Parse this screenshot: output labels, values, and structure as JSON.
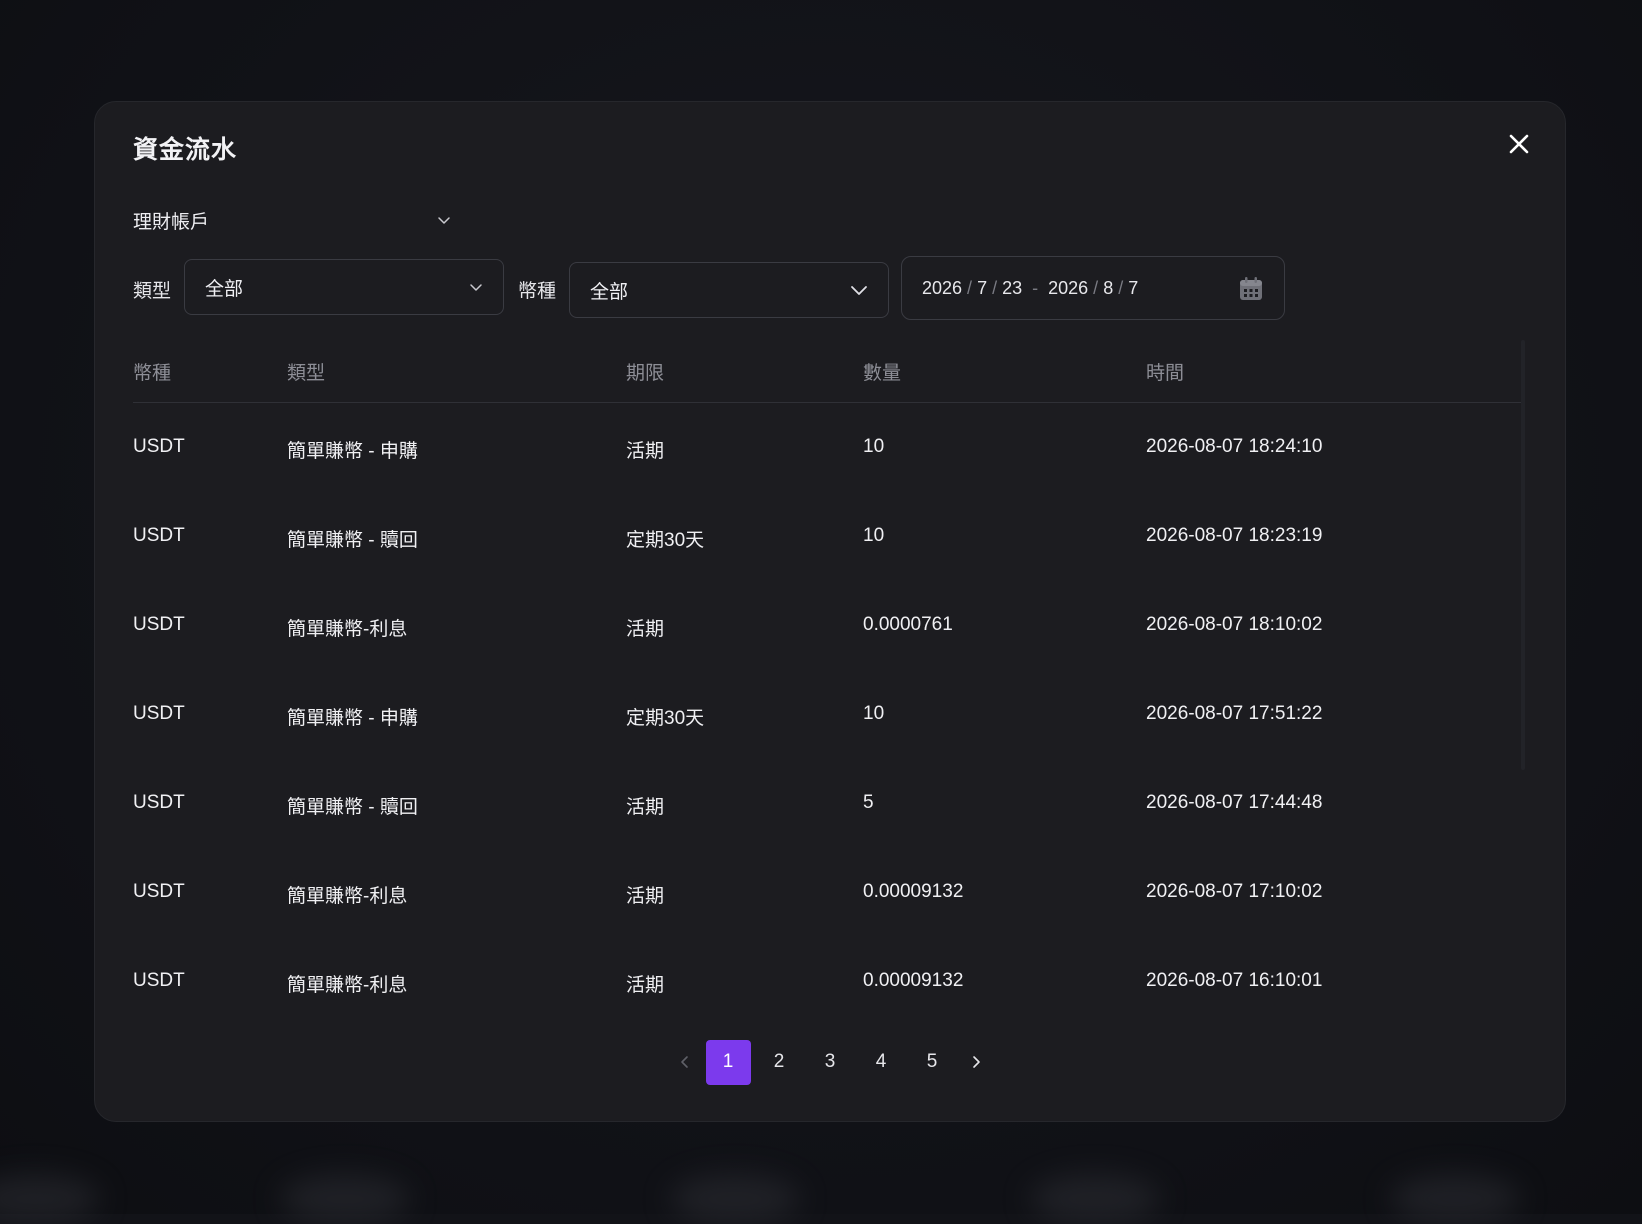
{
  "modal": {
    "title": "資金流水",
    "close_icon": "close-icon"
  },
  "account_select": {
    "value": "理財帳戶"
  },
  "filters": {
    "type_label": "類型",
    "type_value": "全部",
    "currency_label": "幣種",
    "currency_value": "全部",
    "date_start": {
      "year": "2026",
      "month": "7",
      "day": "23"
    },
    "date_end": {
      "year": "2026",
      "month": "8",
      "day": "7"
    },
    "date_part_sep": "/",
    "date_range_sep": "-",
    "calendar_icon": "calendar-icon"
  },
  "table": {
    "headers": [
      "幣種",
      "類型",
      "期限",
      "數量",
      "時間"
    ],
    "rows": [
      [
        "USDT",
        "簡單賺幣 - 申購",
        "活期",
        "10",
        "2026-08-07 18:24:10"
      ],
      [
        "USDT",
        "簡單賺幣 - 贖回",
        "定期30天",
        "10",
        "2026-08-07 18:23:19"
      ],
      [
        "USDT",
        "簡單賺幣-利息",
        "活期",
        "0.0000761",
        "2026-08-07 18:10:02"
      ],
      [
        "USDT",
        "簡單賺幣 - 申購",
        "定期30天",
        "10",
        "2026-08-07 17:51:22"
      ],
      [
        "USDT",
        "簡單賺幣 - 贖回",
        "活期",
        "5",
        "2026-08-07 17:44:48"
      ],
      [
        "USDT",
        "簡單賺幣-利息",
        "活期",
        "0.00009132",
        "2026-08-07 17:10:02"
      ],
      [
        "USDT",
        "簡單賺幣-利息",
        "活期",
        "0.00009132",
        "2026-08-07 16:10:01"
      ]
    ]
  },
  "pagination": {
    "pages": [
      "1",
      "2",
      "3",
      "4",
      "5"
    ],
    "current": "1"
  },
  "colors": {
    "accent": "#7c3aed",
    "modal_bg": "#1c1c20",
    "page_bg": "#121318",
    "header_text": "#8d8e96"
  }
}
